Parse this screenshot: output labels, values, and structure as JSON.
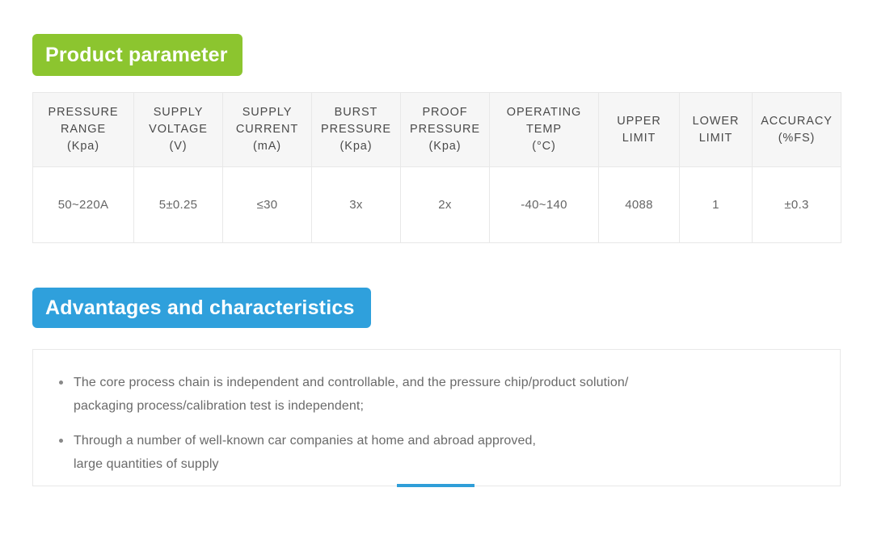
{
  "sections": {
    "parameter": {
      "badge_label": "Product parameter",
      "badge_color": "#8cc52f"
    },
    "advantages": {
      "badge_label": "Advantages and characteristics",
      "badge_color": "#2fa0dc",
      "accent_color": "#2f9ed8"
    }
  },
  "param_table": {
    "columns": [
      {
        "line1": "PRESSURE",
        "line2": "RANGE",
        "line3": "(Kpa)"
      },
      {
        "line1": "SUPPLY",
        "line2": "VOLTAGE",
        "line3": "(V)"
      },
      {
        "line1": "SUPPLY",
        "line2": "CURRENT",
        "line3": "(mA)"
      },
      {
        "line1": "BURST",
        "line2": "PRESSURE",
        "line3": "(Kpa)"
      },
      {
        "line1": "PROOF",
        "line2": "PRESSURE",
        "line3": "(Kpa)"
      },
      {
        "line1": "OPERATING",
        "line2": "TEMP",
        "line3": "(°C)"
      },
      {
        "line1": "UPPER",
        "line2": "LIMIT",
        "line3": ""
      },
      {
        "line1": "LOWER",
        "line2": "LIMIT",
        "line3": ""
      },
      {
        "line1": "ACCURACY",
        "line2": "(%FS)",
        "line3": ""
      }
    ],
    "rows": [
      [
        "50~220A",
        "5±0.25",
        "≤30",
        "3x",
        "2x",
        "-40~140",
        "4088",
        "1",
        "±0.3"
      ]
    ]
  },
  "advantages_list": [
    {
      "line1": "The core process chain is independent and controllable, and the pressure chip/product solution/",
      "line2": "packaging process/calibration test is independent;"
    },
    {
      "line1": "Through a number of well-known car companies at home and abroad approved,",
      "line2": "large quantities of supply"
    }
  ]
}
